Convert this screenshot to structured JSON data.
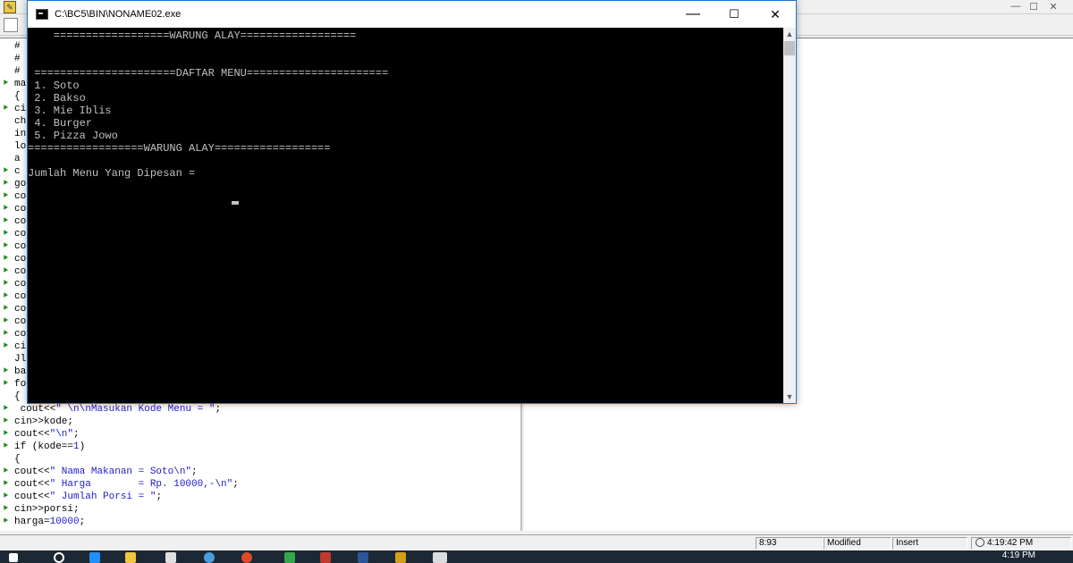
{
  "console": {
    "title": "C:\\BC5\\BIN\\NONAME02.exe",
    "controls": {
      "minimize": "—",
      "maximize": "☐",
      "close": "✕"
    },
    "lines": [
      "    ==================WARUNG ALAY==================",
      "",
      "",
      " ======================DAFTAR MENU======================",
      " 1. Soto",
      " 2. Bakso",
      " 3. Mie Iblis",
      " 4. Burger",
      " 5. Pizza Jowo",
      "==================WARUNG ALAY==================",
      "",
      "Jumlah Menu Yang Dipesan =  "
    ]
  },
  "editor": {
    "partial_lines": [
      {
        "text": "#",
        "bp": false
      },
      {
        "text": "#",
        "bp": false
      },
      {
        "text": "#",
        "bp": false
      },
      {
        "text": "ma",
        "bp": true
      },
      {
        "text": "{",
        "bp": false
      },
      {
        "text": "ci",
        "bp": true
      },
      {
        "text": "ch",
        "bp": false
      },
      {
        "text": "in",
        "bp": false
      },
      {
        "text": "lo",
        "bp": false
      },
      {
        "text": "a",
        "bp": false
      },
      {
        "text": "c",
        "bp": true
      },
      {
        "text": "go",
        "bp": true
      },
      {
        "text": "co",
        "bp": true
      },
      {
        "text": "co",
        "bp": true
      },
      {
        "text": "co",
        "bp": true
      },
      {
        "text": "co",
        "bp": true
      },
      {
        "text": "co",
        "bp": true
      },
      {
        "text": "co",
        "bp": true
      },
      {
        "text": "co",
        "bp": true
      },
      {
        "text": "co",
        "bp": true
      },
      {
        "text": "co",
        "bp": true
      },
      {
        "text": "co",
        "bp": true
      },
      {
        "text": "co",
        "bp": true
      },
      {
        "text": "co",
        "bp": true
      },
      {
        "text": "ci",
        "bp": true
      },
      {
        "text": "Jl",
        "bp": false
      },
      {
        "text": "ba",
        "bp": true
      },
      {
        "text": "fo",
        "bp": true
      },
      {
        "text": "{",
        "bp": false
      }
    ],
    "full_lines": [
      {
        "pre": " cout<<",
        "str": "\" \\n\\nMasukan Kode Menu = \"",
        "post": ";",
        "bp": true
      },
      {
        "pre": "cin>>kode;",
        "str": "",
        "post": "",
        "bp": true
      },
      {
        "pre": "cout<<",
        "str": "\"\\n\"",
        "post": ";",
        "bp": true
      },
      {
        "pre": "if (kode==",
        "str": "1",
        "post": ")",
        "bp": true
      },
      {
        "pre": "{",
        "str": "",
        "post": "",
        "bp": false
      },
      {
        "pre": "cout<<",
        "str": "\" Nama Makanan = Soto\\n\"",
        "post": ";",
        "bp": true
      },
      {
        "pre": "cout<<",
        "str": "\" Harga        = Rp. 10000,-\\n\"",
        "post": ";",
        "bp": true
      },
      {
        "pre": "cout<<",
        "str": "\" Jumlah Porsi = \"",
        "post": ";",
        "bp": true
      },
      {
        "pre": "cin>>porsi;",
        "str": "",
        "post": "",
        "bp": true
      },
      {
        "pre": "harga=",
        "str": "10000",
        "post": ";",
        "bp": true
      }
    ]
  },
  "statusbar": {
    "position": "8:93",
    "state": "Modified",
    "mode": "Insert",
    "time": "4:19:42 PM"
  },
  "taskbar": {
    "clock": "4:19 PM"
  }
}
